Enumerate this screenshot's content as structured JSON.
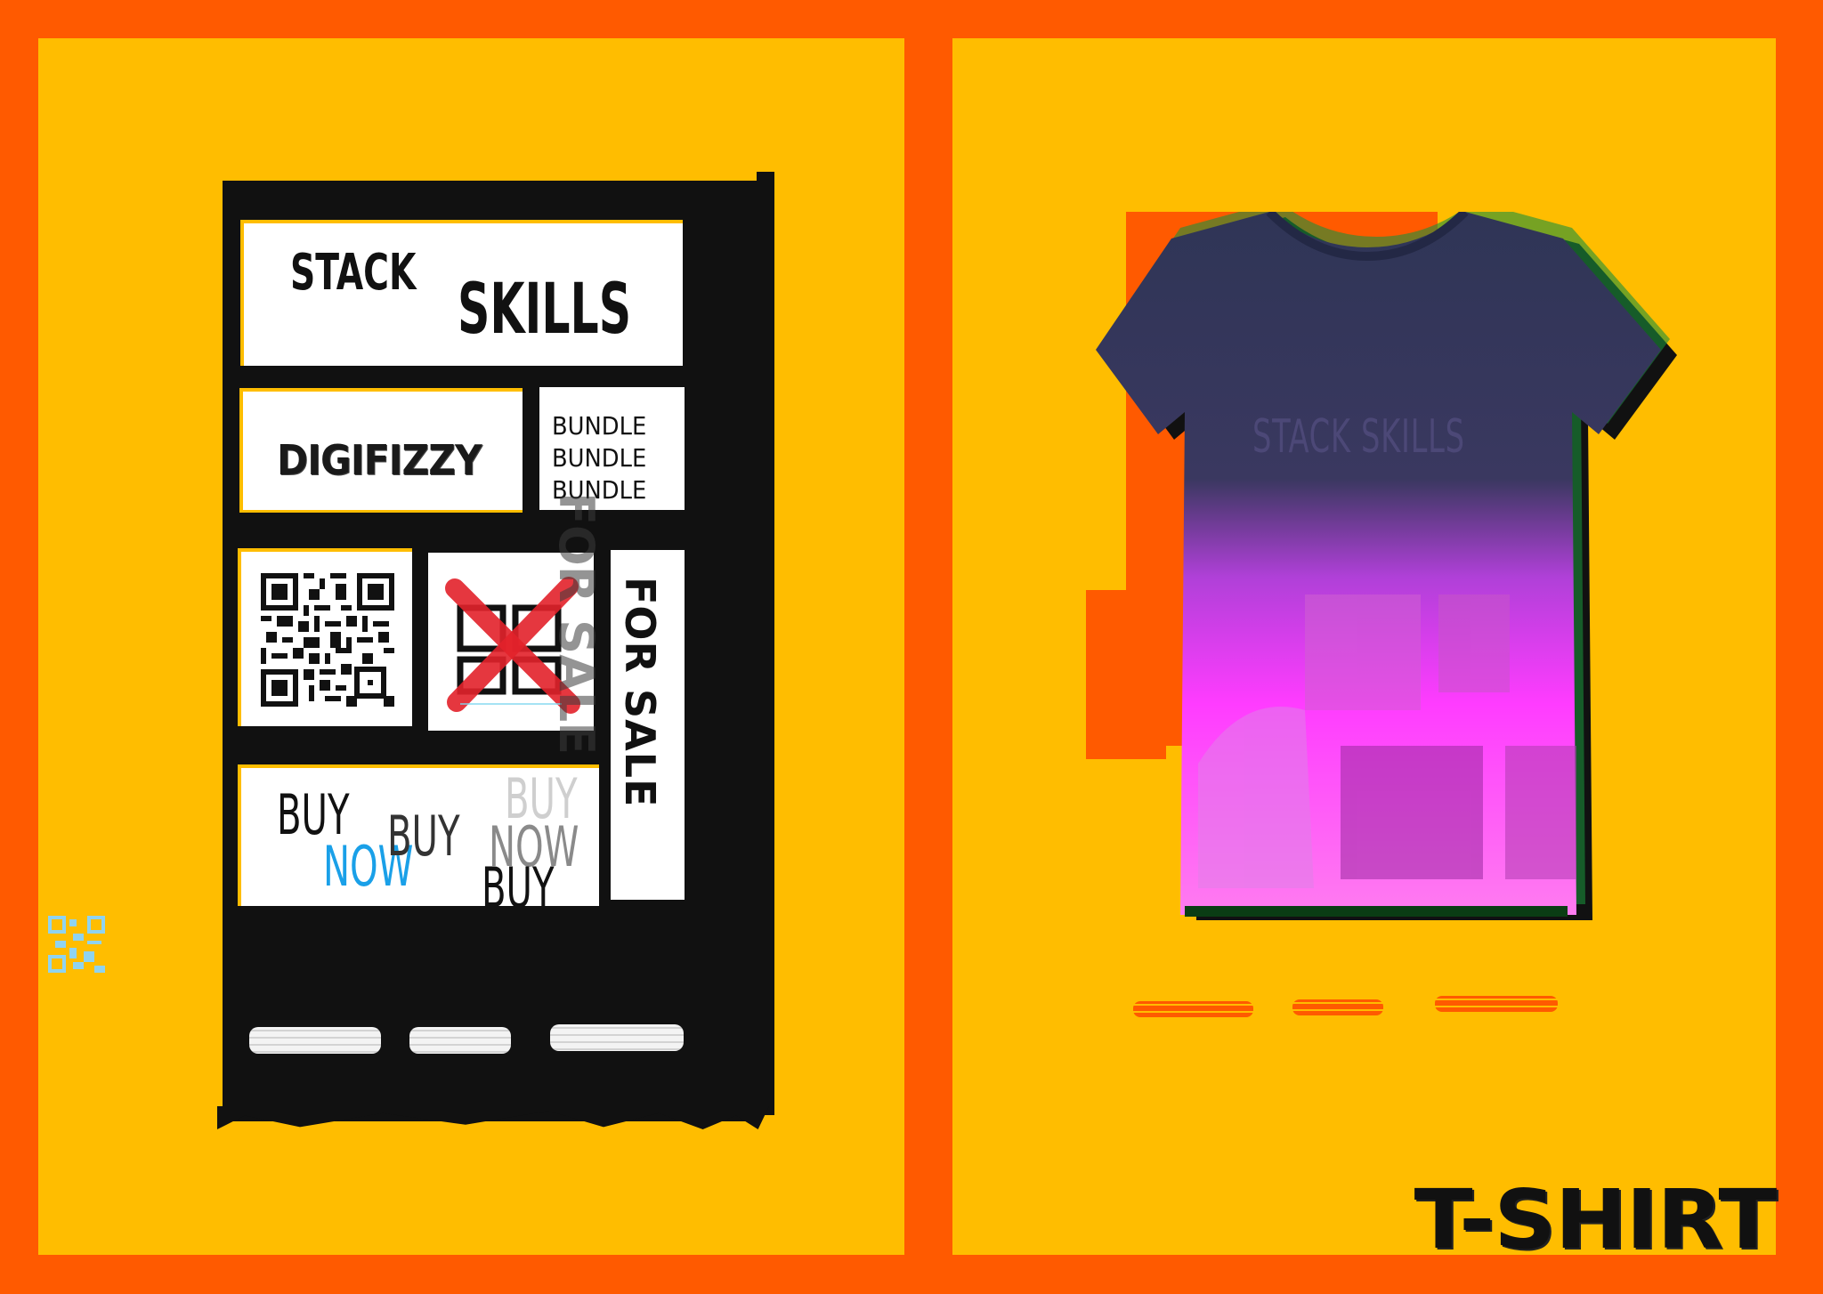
{
  "poster": {
    "background_color": "#ff5a00",
    "panel_color": "#ffbd00"
  },
  "left_panel": {
    "card_stack_skills": {
      "line1": "STACK",
      "line2": "SKILLS"
    },
    "card_brand": {
      "text": "DIGIFIZZY"
    },
    "card_bundle": {
      "lines": [
        "BUNDLE",
        "BUNDLE",
        "BUNDLE"
      ]
    },
    "card_qr": {
      "icon": "qr-code-icon"
    },
    "card_crossed": {
      "icon": "crossed-out-qr-icon",
      "cross_color": "#e3222b"
    },
    "card_for_sale": {
      "text": "FOR SALE"
    },
    "ghost_for_sale": {
      "text": "FOR SALE"
    },
    "card_buy": {
      "words": [
        {
          "text": "BUY",
          "color": "#111111"
        },
        {
          "text": "NOW",
          "color": "#1aa0e8"
        },
        {
          "text": "BUY",
          "color": "#333333"
        },
        {
          "text": "BUY",
          "color": "#cfcfcf"
        },
        {
          "text": "NOW",
          "color": "#8a8a8a"
        },
        {
          "text": "BUY",
          "color": "#111111"
        }
      ]
    },
    "mini_qr": {
      "icon": "small-qr-icon",
      "color": "#8fd3f0"
    }
  },
  "right_panel": {
    "tshirt": {
      "icon": "tshirt-mockup",
      "print_text": "STACK SKILLS",
      "fabric_color": "#2f3556",
      "gradient_color": "#ff3cff"
    },
    "label": "T-SHIRT"
  }
}
